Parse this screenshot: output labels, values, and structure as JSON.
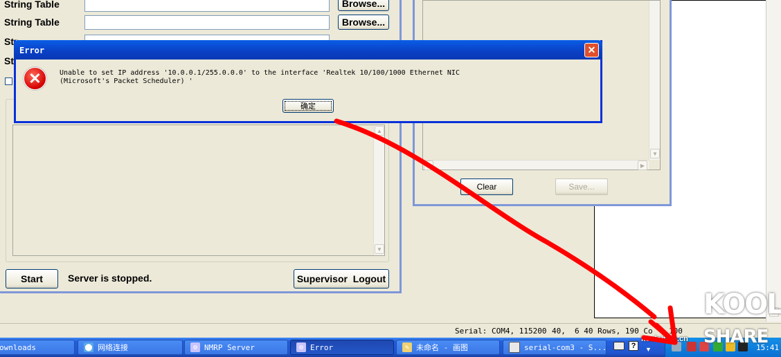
{
  "nmrp": {
    "rows": [
      {
        "label": "String Table",
        "browse": "Browse..."
      },
      {
        "label": "String Table",
        "browse": "Browse..."
      },
      {
        "label": "Str"
      },
      {
        "label": "Str"
      }
    ],
    "start_label": "Start",
    "status_text": "Server is stopped.",
    "supervisor_label": "Supervisor  Logout"
  },
  "serial_panel": {
    "clear_label": "Clear",
    "save_label": "Save..."
  },
  "statusbar": {
    "port": "Serial: COM4, 115200",
    "pos": "40,",
    "size": "6 40 Rows, 190 Co",
    "tail": "100"
  },
  "error_dialog": {
    "title": "Error",
    "close": "✕",
    "message_line1": "Unable to set IP address '10.0.0.1/255.0.0.0' to the interface 'Realtek 10/100/1000 Ethernet NIC",
    "message_line2": "(Microsoft's Packet Scheduler) '",
    "ok_label": "确定"
  },
  "taskbar": {
    "items": [
      {
        "label": "ownloads"
      },
      {
        "label": "网络连接"
      },
      {
        "label": "NMRP Server"
      },
      {
        "label": "Error"
      },
      {
        "label": "未命名 - 画图"
      },
      {
        "label": "serial-com3 - S..."
      }
    ],
    "clock": "15:41"
  },
  "watermark": {
    "site": "koolshare.cn",
    "line1": "KOOL",
    "line2": "SHARE"
  },
  "colors": {
    "dialog_border": "#0831d9",
    "taskbar": "#245edb",
    "annotation_arrow": "#ff0000"
  }
}
